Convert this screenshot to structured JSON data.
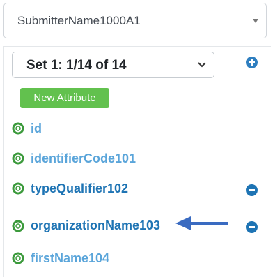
{
  "submitter_select": {
    "value": "SubmitterName1000A1"
  },
  "set_select": {
    "value": "Set 1: 1/14 of 14"
  },
  "new_attribute_label": "New Attribute",
  "attributes": [
    {
      "label": "id",
      "style": "light",
      "removable": false
    },
    {
      "label": "identifierCode101",
      "style": "light",
      "removable": false
    },
    {
      "label": "typeQualifier102",
      "style": "dark",
      "removable": true
    },
    {
      "label": "organizationName103",
      "style": "dark",
      "removable": true
    },
    {
      "label": "firstName104",
      "style": "light",
      "removable": false
    }
  ],
  "colors": {
    "accent_dark": "#1e74b4",
    "accent_light": "#5aa5da",
    "green_button": "#62c14e",
    "icon_green": "#3c9a3c",
    "arrow": "#3a6bc1"
  }
}
